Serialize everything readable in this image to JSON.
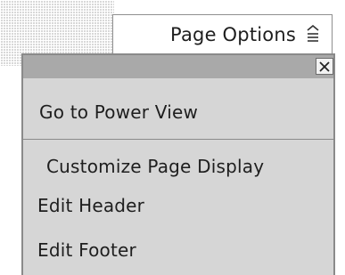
{
  "page_options": {
    "label": "Page Options",
    "icon": "collapse-up-icon"
  },
  "menu": {
    "close_icon": "close-icon",
    "items": [
      {
        "label": "Go to Power View"
      },
      {
        "label": "Customize Page Display"
      },
      {
        "label": "Edit Header"
      },
      {
        "label": "Edit Footer"
      }
    ]
  },
  "colors": {
    "menu_background": "#d6d6d6",
    "titlebar": "#a9a9a9",
    "border": "#8a8a8a",
    "text": "#1e1e1e"
  }
}
